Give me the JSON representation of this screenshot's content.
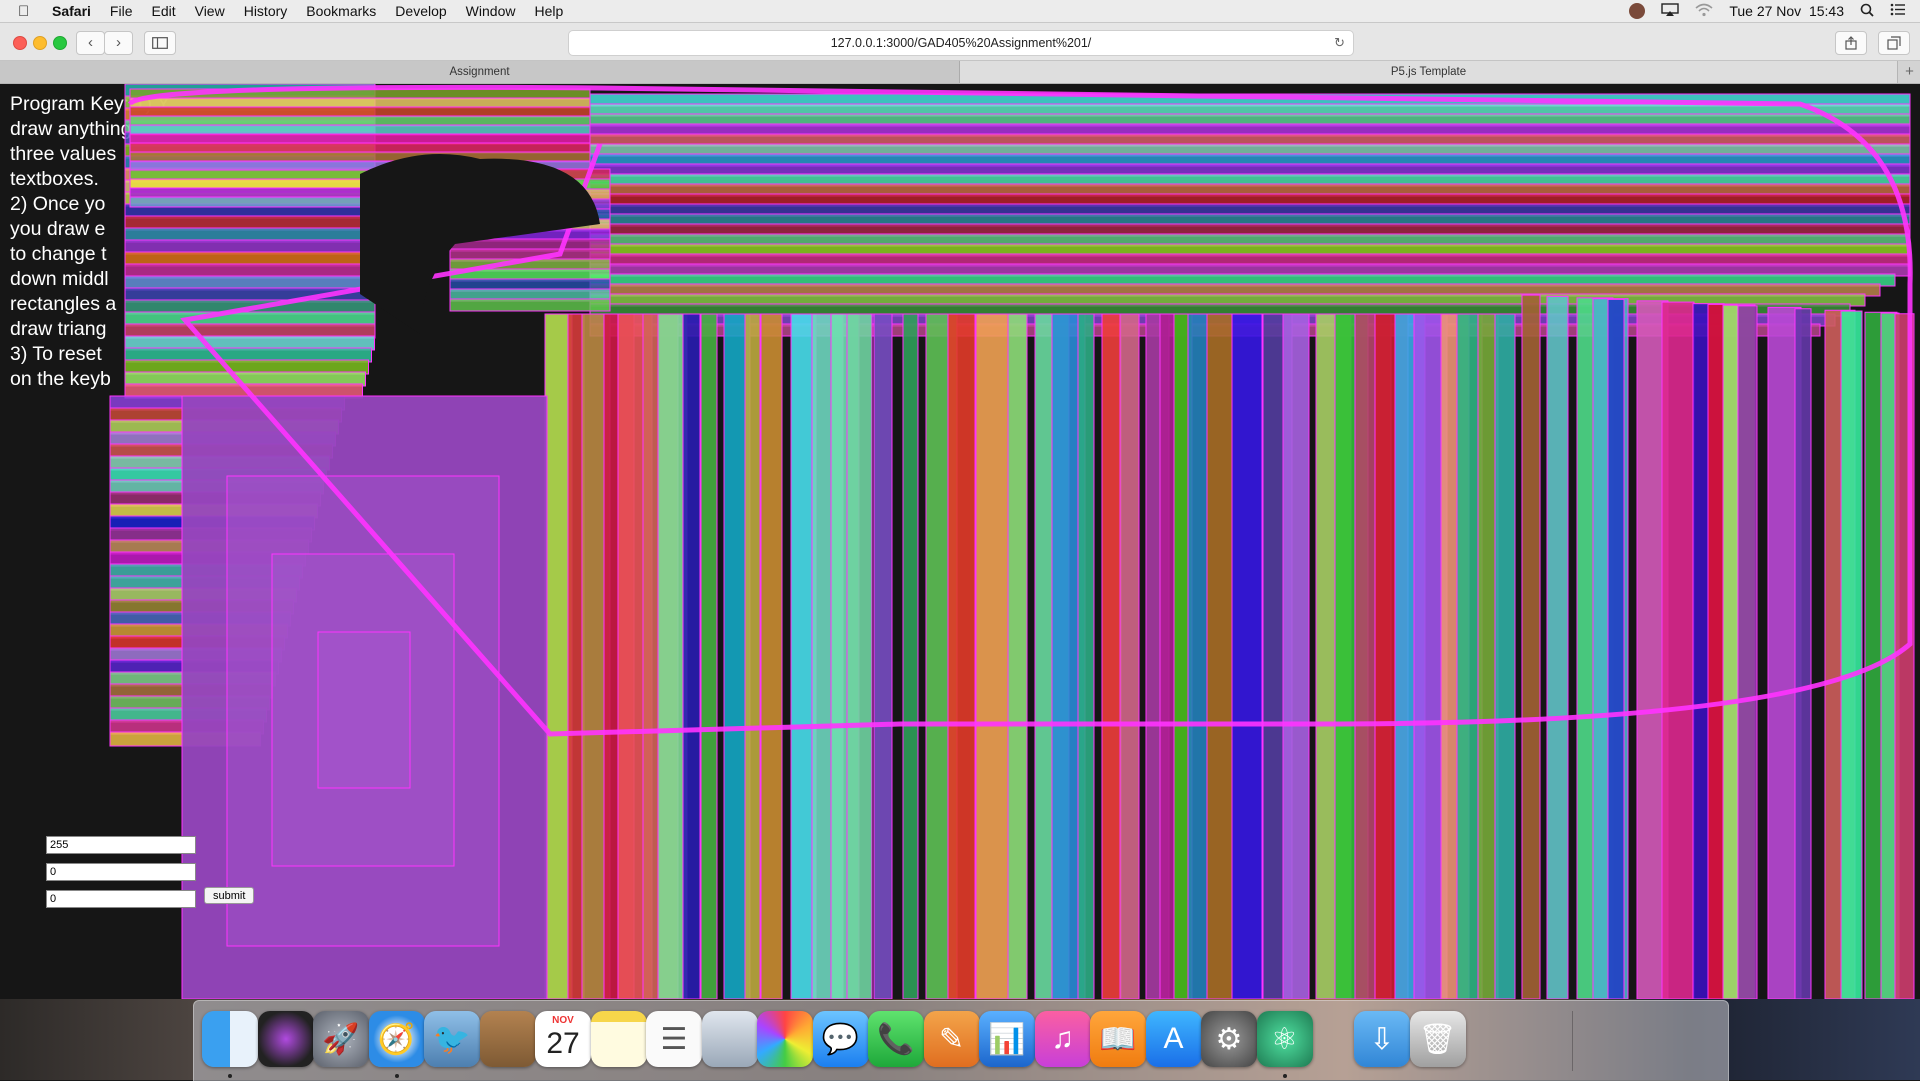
{
  "menubar": {
    "app": "Safari",
    "items": [
      "File",
      "Edit",
      "View",
      "History",
      "Bookmarks",
      "Develop",
      "Window",
      "Help"
    ],
    "clock": "Tue 27 Nov  15:43"
  },
  "toolbar": {
    "url": "127.0.0.1:3000/GAD405%20Assignment%201/"
  },
  "tabs": [
    "Assignment",
    "P5.js Template"
  ],
  "page": {
    "program_key": "Program Key: 1) Y\ndraw anything\nthree values\ntextboxes.\n2) Once yo\nyou draw e\nto change t\ndown middl\nrectangles a\ndraw triang\n3) To reset\non the keyb",
    "inputs": [
      "255",
      "0",
      "0"
    ],
    "submit_label": "submit"
  },
  "dock": {
    "calendar": {
      "month": "NOV",
      "day": "27"
    },
    "apps": [
      "finder-icon",
      "siri-icon",
      "launchpad-icon",
      "safari-icon",
      "mail-icon",
      "contacts-icon",
      "calendar-icon",
      "notes-icon",
      "reminders-icon",
      "preview-icon",
      "photos-icon",
      "messages-icon",
      "facetime-icon",
      "pages-icon",
      "keynote-icon",
      "itunes-icon",
      "ibooks-icon",
      "app-store-icon",
      "system-preferences-icon",
      "atom-icon",
      "downloads-icon",
      "trash-icon"
    ]
  },
  "colors": {
    "accent_magenta": "#ff33ff",
    "background": "#161616"
  }
}
